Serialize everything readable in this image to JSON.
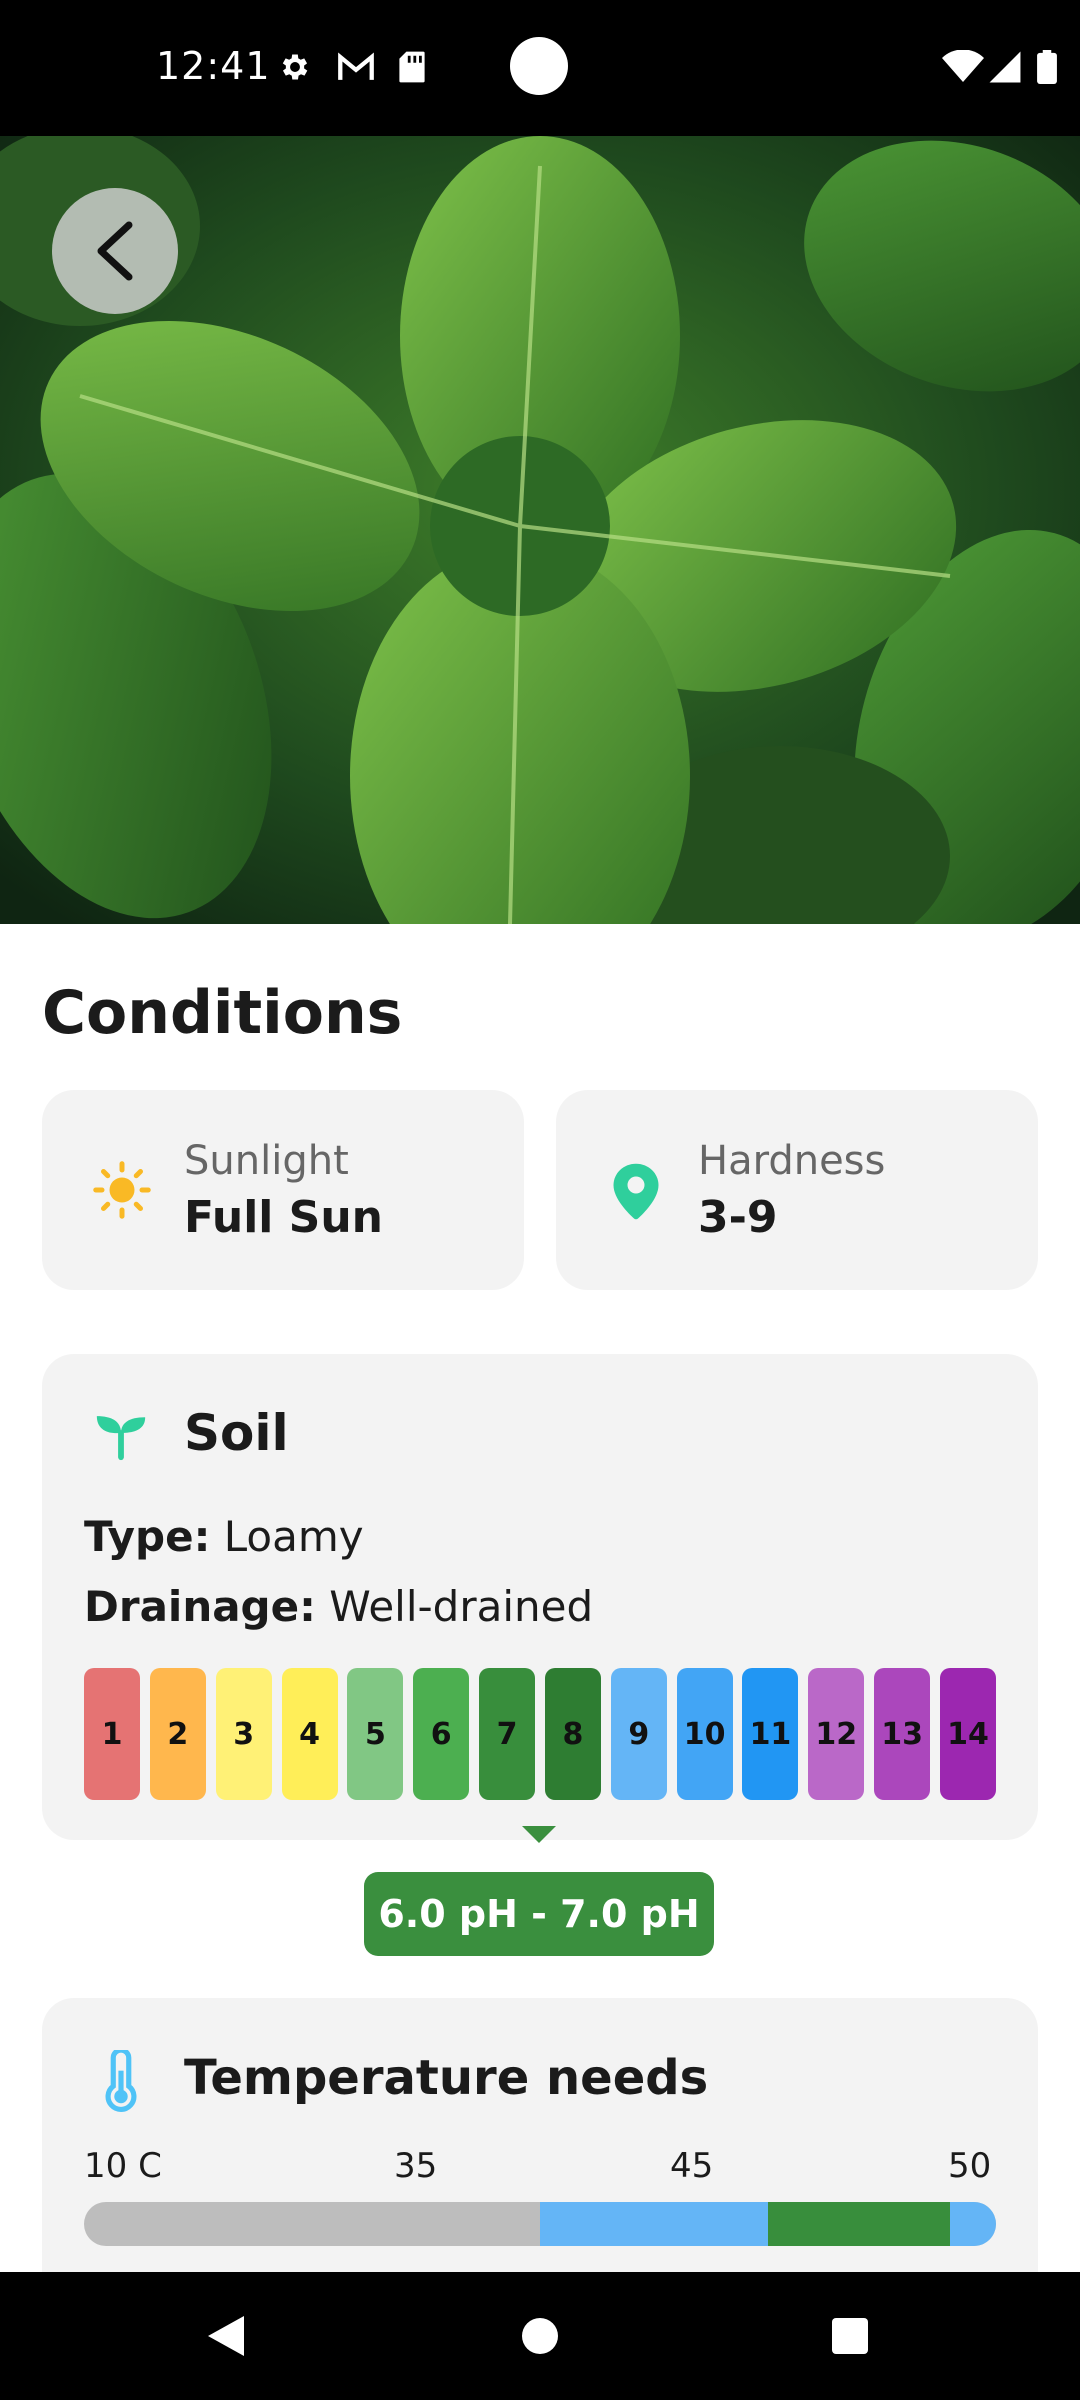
{
  "status_bar": {
    "time": "12:41",
    "icons": [
      "settings-icon",
      "gmail-icon",
      "sd-card-icon",
      "wifi-icon",
      "signal-icon",
      "battery-icon"
    ]
  },
  "hero": {
    "image": "nettle-leaves-photo",
    "back_icon": "chevron-left-icon"
  },
  "conditions": {
    "title": "Conditions",
    "sunlight": {
      "label": "Sunlight",
      "value": "Full Sun",
      "icon": "sun-icon",
      "color": "#f9b925"
    },
    "hardness": {
      "label": "Hardness",
      "value": "3-9",
      "icon": "location-pin-icon",
      "color": "#2fcf9c"
    }
  },
  "soil": {
    "title": "Soil",
    "icon": "sprout-icon",
    "type_label": "Type:",
    "type_value": "Loamy",
    "drainage_label": "Drainage:",
    "drainage_value": "Well-drained",
    "ph_scale": [
      {
        "value": "1",
        "color": "#e57373"
      },
      {
        "value": "2",
        "color": "#ffb74d"
      },
      {
        "value": "3",
        "color": "#fff176"
      },
      {
        "value": "4",
        "color": "#ffee58"
      },
      {
        "value": "5",
        "color": "#81c784"
      },
      {
        "value": "6",
        "color": "#4caf50"
      },
      {
        "value": "7",
        "color": "#388e3c"
      },
      {
        "value": "8",
        "color": "#2e7d32"
      },
      {
        "value": "9",
        "color": "#64b5f6"
      },
      {
        "value": "10",
        "color": "#42a5f5"
      },
      {
        "value": "11",
        "color": "#2196f3"
      },
      {
        "value": "12",
        "color": "#ba68c8"
      },
      {
        "value": "13",
        "color": "#ab47bc"
      },
      {
        "value": "14",
        "color": "#9c27b0"
      }
    ],
    "ph_range": "6.0 pH - 7.0 pH"
  },
  "temperature": {
    "title": "Temperature needs",
    "icon": "thermometer-icon",
    "ticks": [
      "10 C",
      "35",
      "45",
      "50"
    ],
    "range": {
      "min": 10,
      "max": 50
    },
    "segments": [
      {
        "from": 30,
        "to": 40,
        "color": "#64b5f6"
      },
      {
        "from": 40,
        "to": 48,
        "color": "#388e3c"
      },
      {
        "from": 48,
        "to": 50,
        "color": "#64b5f6"
      }
    ]
  },
  "nav_bar": {
    "back": "back-triangle-icon",
    "home": "home-circle-icon",
    "recents": "recents-square-icon"
  }
}
